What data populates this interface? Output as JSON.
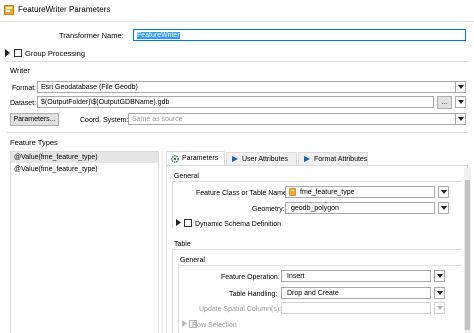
{
  "window": {
    "title": "FeatureWriter Parameters"
  },
  "transformer": {
    "label": "Transformer Name:",
    "value": "FeatureWriter"
  },
  "group_processing": {
    "label": "Group Processing"
  },
  "writer": {
    "section_label": "Writer",
    "format_label": "Format:",
    "format_value": "Esri Geodatabase (File Geodb)",
    "dataset_label": "Dataset:",
    "dataset_value": "$(OutputFolder)\\$(OutputGDBName).gdb",
    "browse_label": "...",
    "parameters_button": "Parameters...",
    "coord_label": "Coord. System:",
    "coord_placeholder": "Same as source"
  },
  "feature_types": {
    "section_label": "Feature Types",
    "items": [
      "@Value(fme_feature_type)",
      "@Value(fme_feature_type)"
    ]
  },
  "tabs": [
    {
      "label": "Parameters",
      "icon": "gear-icon"
    },
    {
      "label": "User Attributes",
      "icon": "user-attributes-icon"
    },
    {
      "label": "Format Attributes",
      "icon": "format-attributes-icon"
    }
  ],
  "params": {
    "general_label": "General",
    "fc_name_label": "Feature Class or Table Name:",
    "fc_name_value": "fme_feature_type",
    "geometry_label": "Geometry:",
    "geometry_value": "geodb_polygon",
    "dynamic_schema_label": "Dynamic Schema Definition",
    "table_label": "Table",
    "table_general_label": "General",
    "feature_op_label": "Feature Operation:",
    "feature_op_value": "Insert",
    "table_handling_label": "Table Handling:",
    "table_handling_value": "Drop and Create",
    "update_spatial_label": "Update Spatial Column(s):",
    "row_selection_label": "Row Selection"
  },
  "colors": {
    "accent": "#0078d7",
    "selection": "#3399ff",
    "list_selected": "#e5e5e5"
  }
}
